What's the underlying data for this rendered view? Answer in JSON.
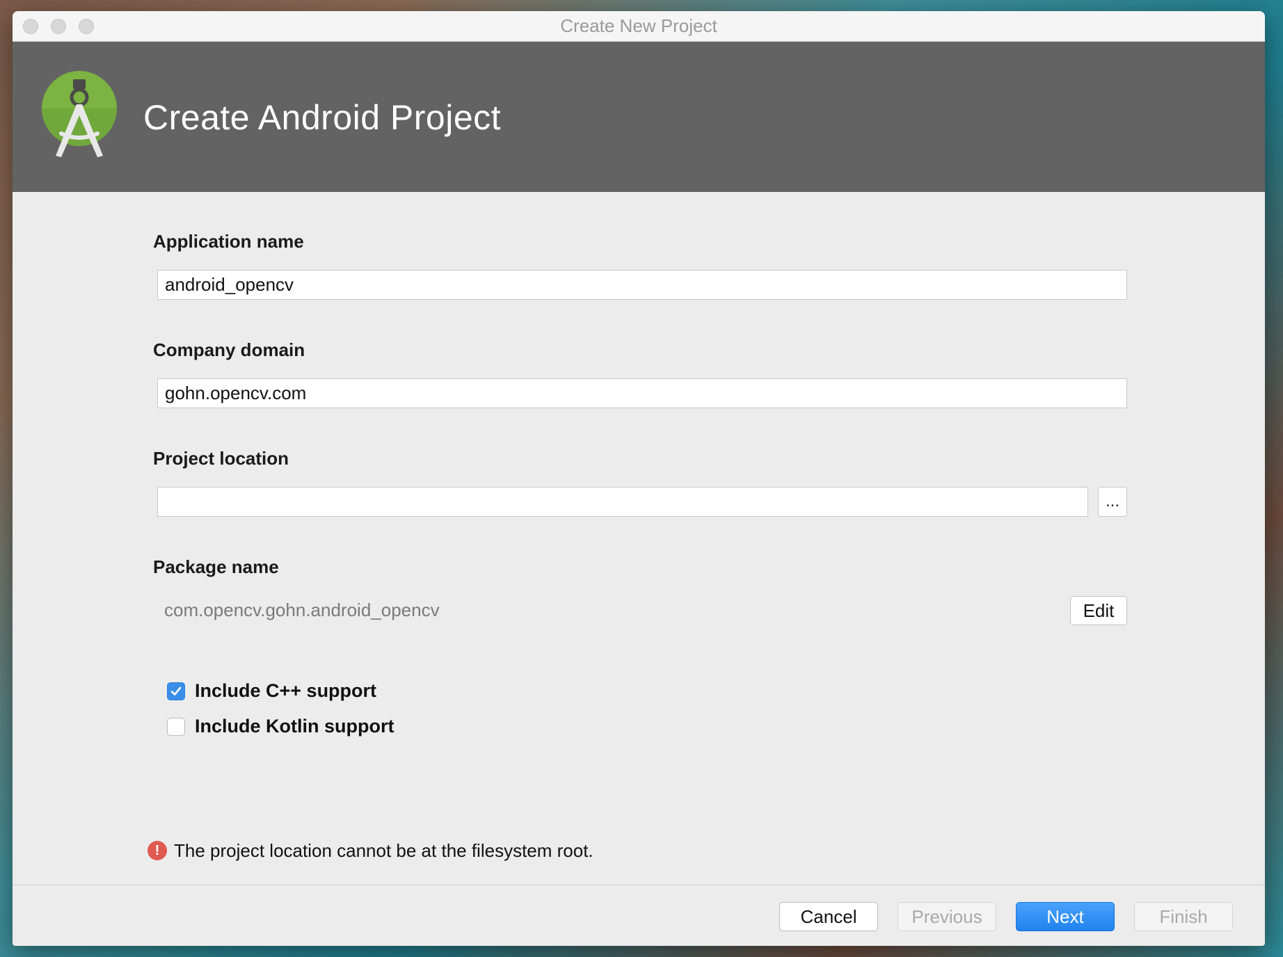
{
  "window": {
    "title": "Create New Project"
  },
  "banner": {
    "title": "Create Android Project",
    "logo_icon": "android-studio-logo-icon",
    "logo_color": "#7cb342"
  },
  "form": {
    "app_name": {
      "label": "Application name",
      "value": "android_opencv"
    },
    "company_domain": {
      "label": "Company domain",
      "value": "gohn.opencv.com"
    },
    "project_location": {
      "label": "Project location",
      "value": "",
      "browse_label": "..."
    },
    "package_name": {
      "label": "Package name",
      "value": "com.opencv.gohn.android_opencv",
      "edit_label": "Edit"
    },
    "options": [
      {
        "label": "Include C++ support",
        "checked": true
      },
      {
        "label": "Include Kotlin support",
        "checked": false
      }
    ]
  },
  "error": {
    "icon": "error-icon",
    "glyph": "!",
    "message": "The project location cannot be at the filesystem root.",
    "color": "#e05a52"
  },
  "footer": {
    "cancel": "Cancel",
    "previous": "Previous",
    "next": "Next",
    "finish": "Finish",
    "accent": "#2f8cf2"
  }
}
